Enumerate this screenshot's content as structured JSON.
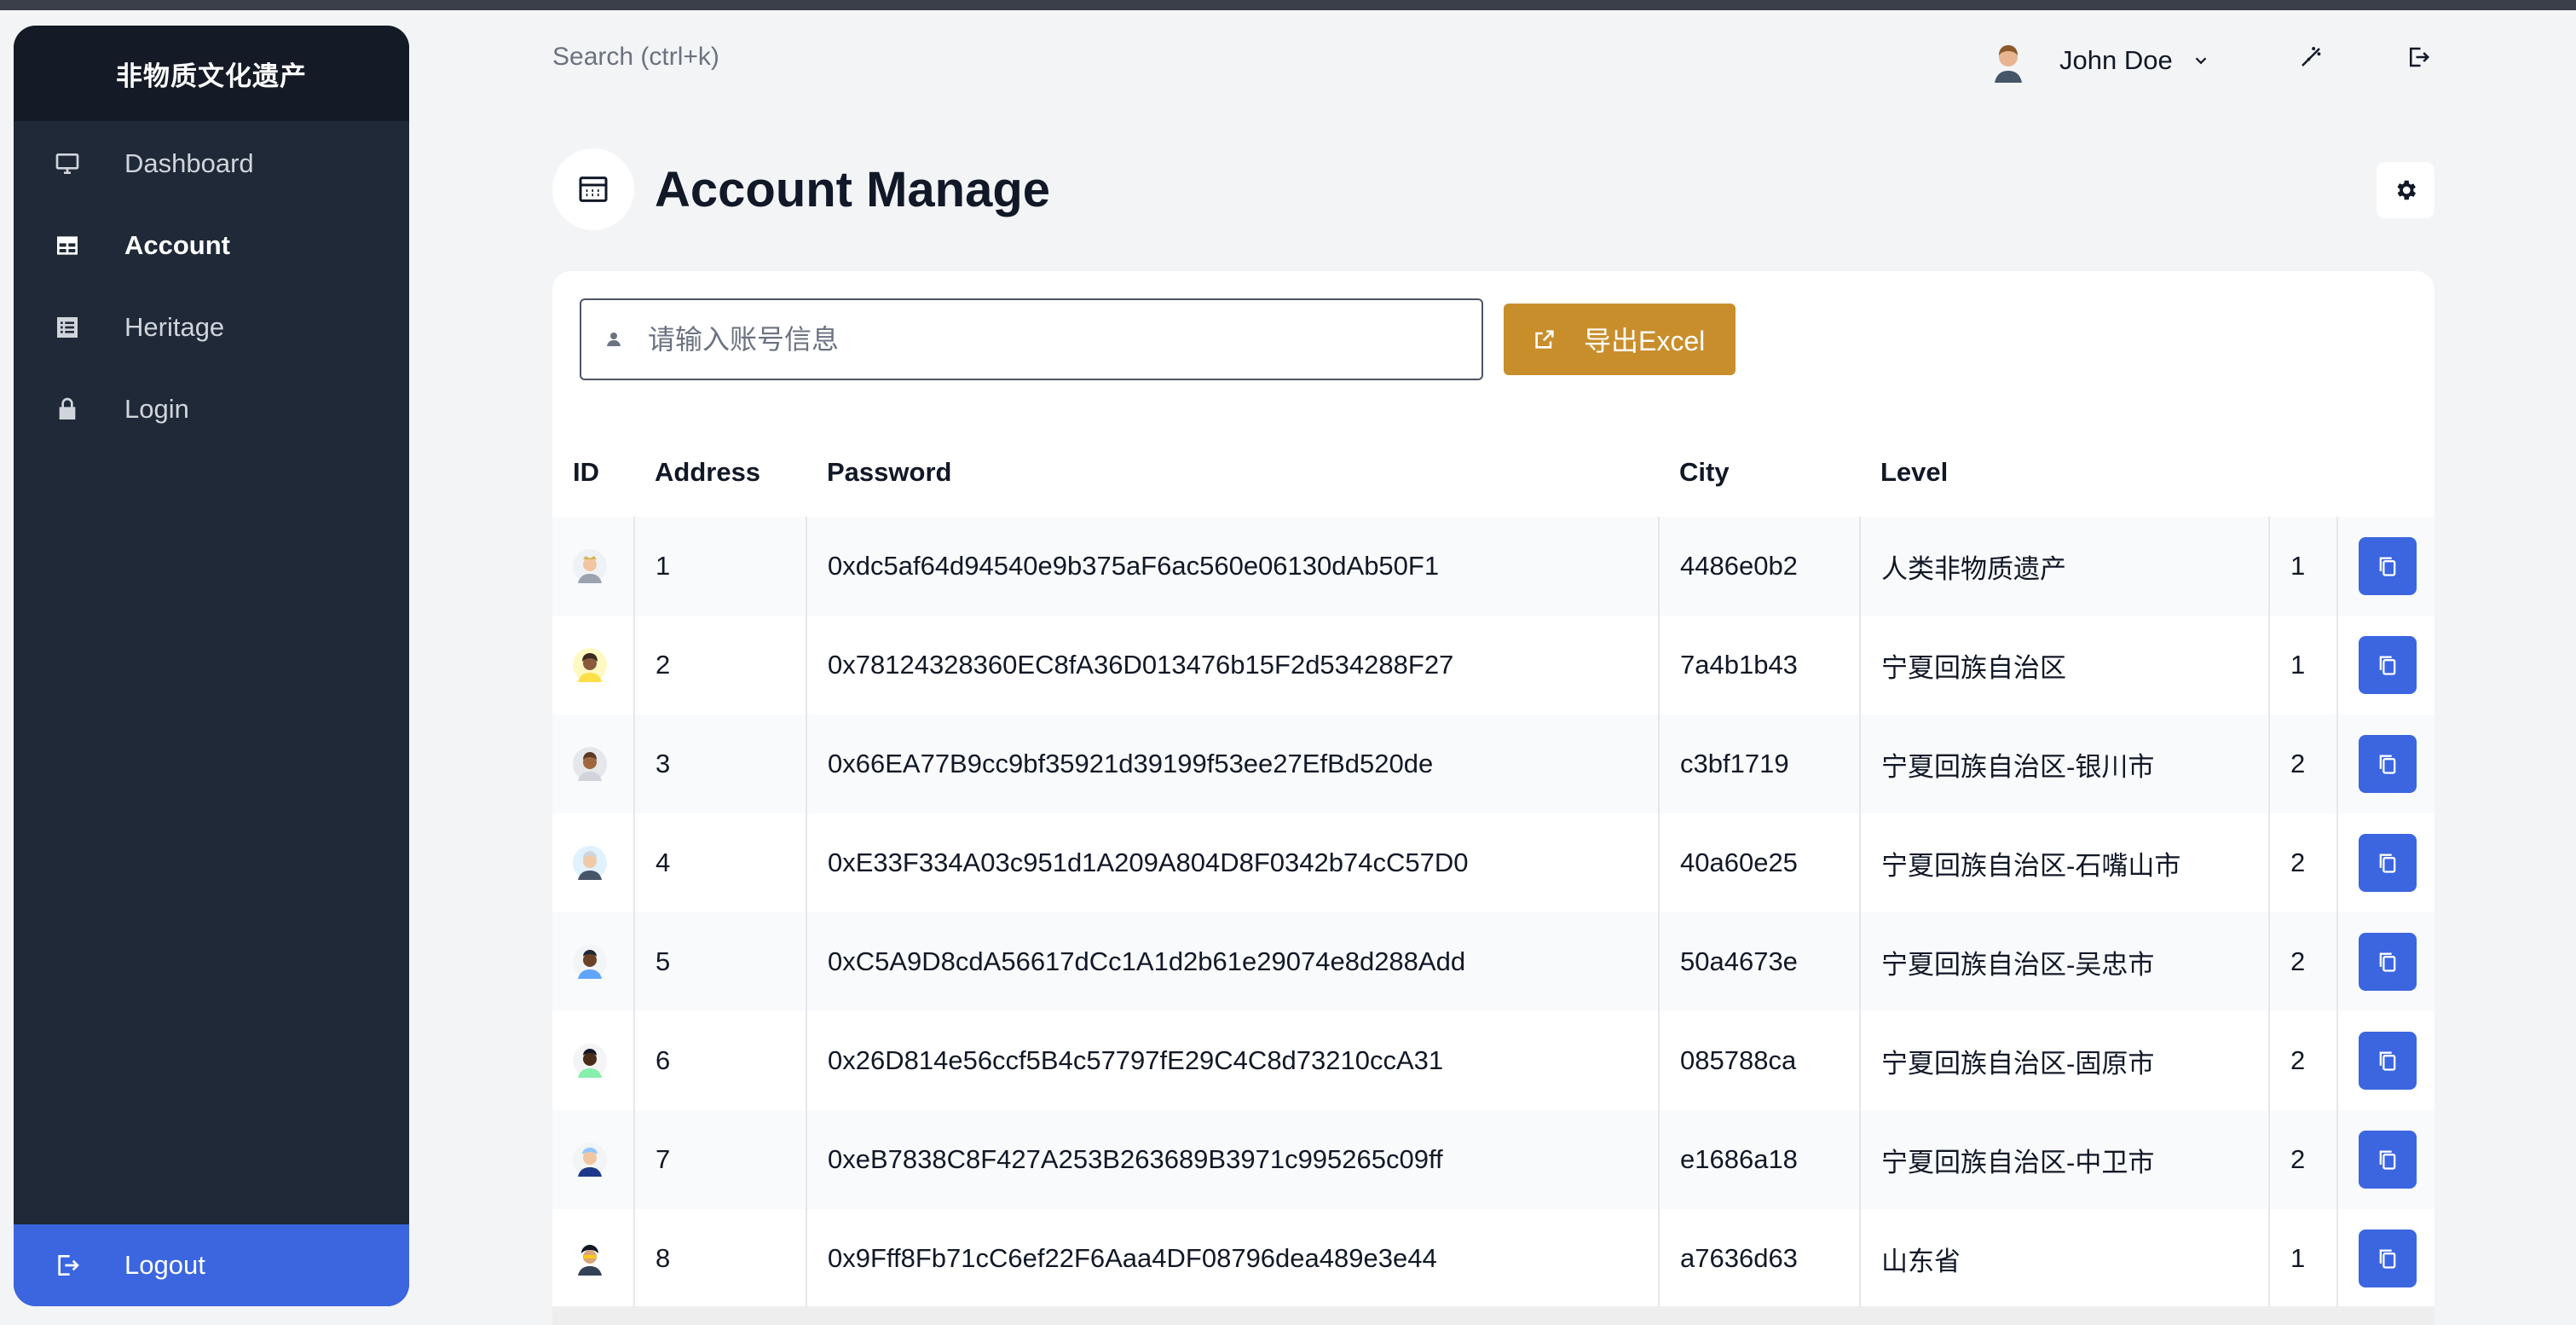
{
  "sidebar": {
    "brand": "非物质文化遗产",
    "items": [
      {
        "label": "Dashboard",
        "icon": "monitor-icon",
        "active": false
      },
      {
        "label": "Account",
        "icon": "table-icon",
        "active": true
      },
      {
        "label": "Heritage",
        "icon": "list-icon",
        "active": false
      },
      {
        "label": "Login",
        "icon": "lock-icon",
        "active": false
      }
    ],
    "logout_label": "Logout"
  },
  "header": {
    "search_label": "Search (ctrl+k)",
    "user_name": "John Doe"
  },
  "page": {
    "title": "Account Manage"
  },
  "toolbar": {
    "search_placeholder": "请输入账号信息",
    "export_label": "导出Excel"
  },
  "table": {
    "columns": [
      "ID",
      "Address",
      "Password",
      "City",
      "Level"
    ],
    "rows": [
      {
        "address": "1",
        "password": "0xdc5af64d94540e9b375aF6ac560e06130dAb50F1",
        "city": "4486e0b2",
        "level": "人类非物质遗产",
        "num": "1"
      },
      {
        "address": "2",
        "password": "0x78124328360EC8fA36D013476b15F2d534288F27",
        "city": "7a4b1b43",
        "level": "宁夏回族自治区",
        "num": "1"
      },
      {
        "address": "3",
        "password": "0x66EA77B9cc9bf35921d39199f53ee27EfBd520de",
        "city": "c3bf1719",
        "level": "宁夏回族自治区-银川市",
        "num": "2"
      },
      {
        "address": "4",
        "password": "0xE33F334A03c951d1A209A804D8F0342b74cC57D0",
        "city": "40a60e25",
        "level": "宁夏回族自治区-石嘴山市",
        "num": "2"
      },
      {
        "address": "5",
        "password": "0xC5A9D8cdA56617dCc1A1d2b61e29074e8d288Add",
        "city": "50a4673e",
        "level": "宁夏回族自治区-吴忠市",
        "num": "2"
      },
      {
        "address": "6",
        "password": "0x26D814e56ccf5B4c57797fE29C4C8d73210ccA31",
        "city": "085788ca",
        "level": "宁夏回族自治区-固原市",
        "num": "2"
      },
      {
        "address": "7",
        "password": "0xeB7838C8F427A253B263689B3971c995265c09ff",
        "city": "e1686a18",
        "level": "宁夏回族自治区-中卫市",
        "num": "2"
      },
      {
        "address": "8",
        "password": "0x9Fff8Fb71cC6ef22F6Aaa4DF08796dea489e3e44",
        "city": "a7636d63",
        "level": "山东省",
        "num": "1"
      }
    ]
  },
  "colors": {
    "sidebar_bg": "#1f2937",
    "accent_blue": "#3b66e0",
    "export_gold": "#c98e2c"
  }
}
